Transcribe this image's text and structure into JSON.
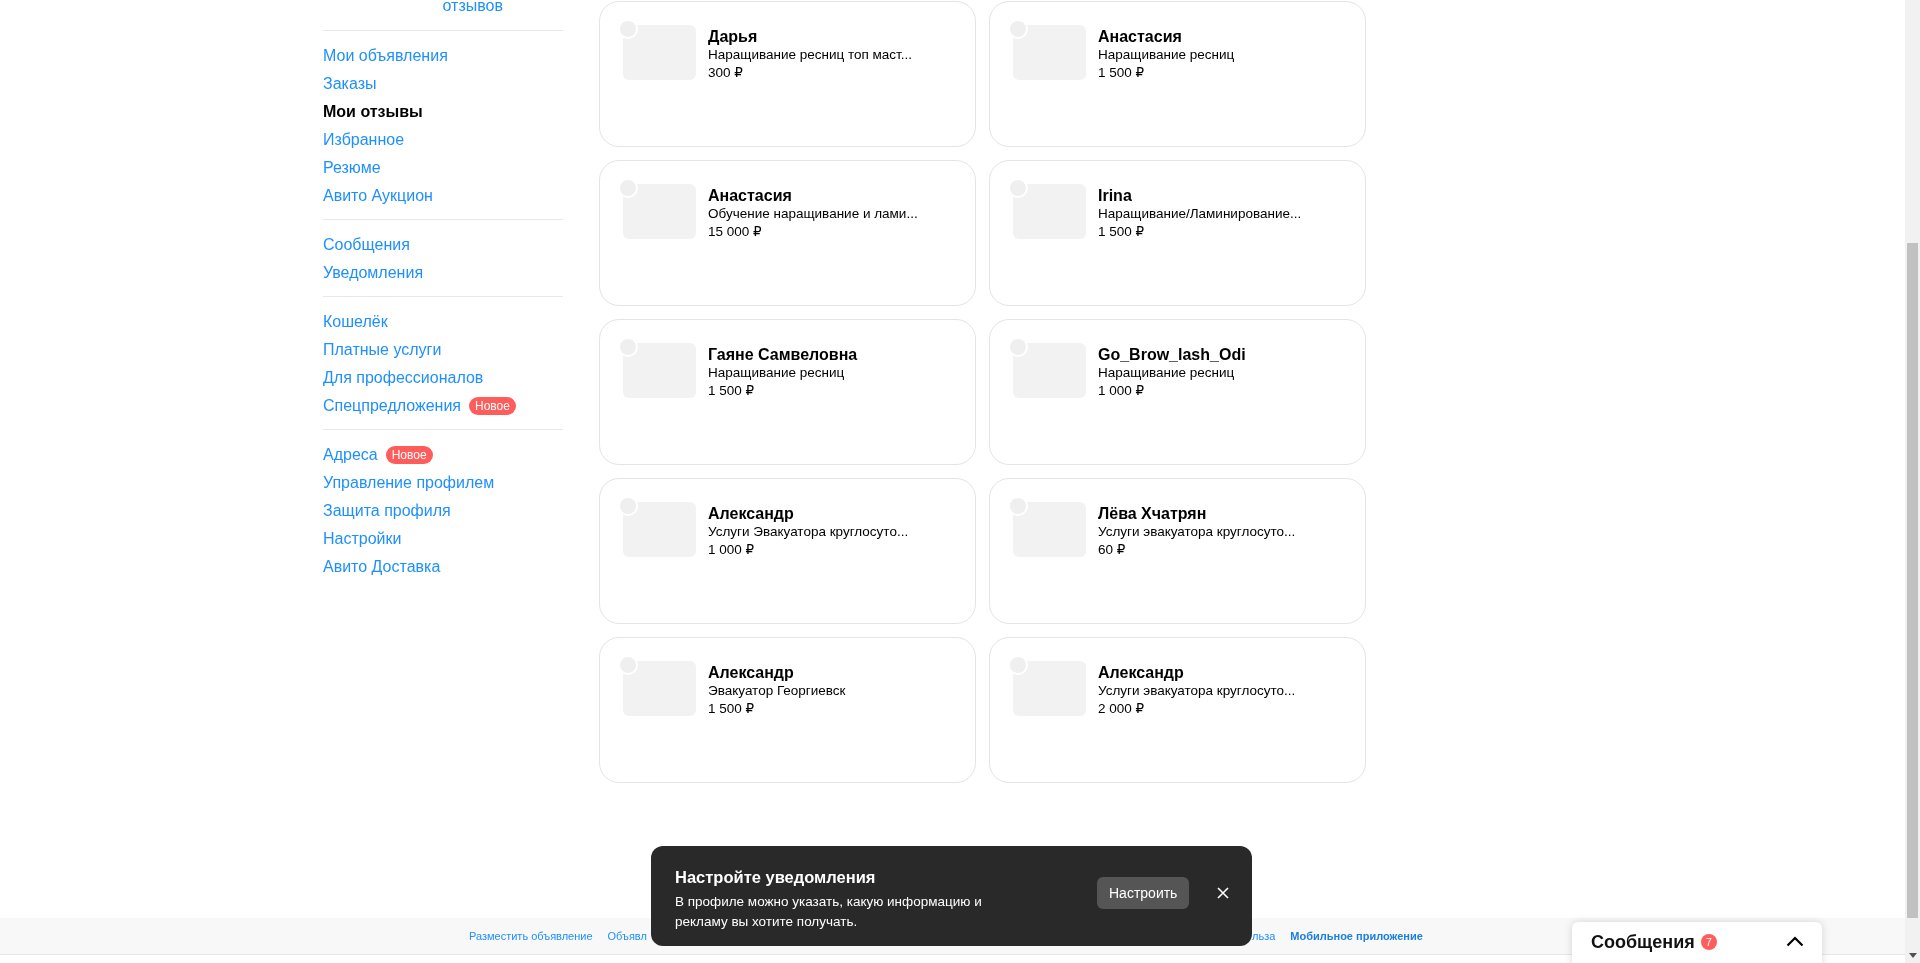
{
  "sidebar": {
    "top_link": "отзывов",
    "groups": [
      [
        {
          "label": "Мои объявления",
          "selected": false
        },
        {
          "label": "Заказы",
          "selected": false
        },
        {
          "label": "Мои отзывы",
          "selected": true
        },
        {
          "label": "Избранное",
          "selected": false
        },
        {
          "label": "Резюме",
          "selected": false
        },
        {
          "label": "Авито Аукцион",
          "selected": false
        }
      ],
      [
        {
          "label": "Сообщения",
          "selected": false
        },
        {
          "label": "Уведомления",
          "selected": false
        }
      ],
      [
        {
          "label": "Кошелёк",
          "selected": false
        },
        {
          "label": "Платные услуги",
          "selected": false
        },
        {
          "label": "Для профессионалов",
          "selected": false
        },
        {
          "label": "Спецпредложения",
          "selected": false,
          "badge": "Новое"
        }
      ],
      [
        {
          "label": "Адреса",
          "selected": false,
          "badge": "Новое"
        },
        {
          "label": "Управление профилем",
          "selected": false
        },
        {
          "label": "Защита профиля",
          "selected": false
        },
        {
          "label": "Настройки",
          "selected": false
        },
        {
          "label": "Авито Доставка",
          "selected": false
        }
      ]
    ]
  },
  "reviews": [
    {
      "name": "Дарья",
      "description": "Наращивание ресниц топ маст...",
      "price": "300 ₽"
    },
    {
      "name": "Анастасия",
      "description": "Наращивание ресниц",
      "price": "1 500 ₽"
    },
    {
      "name": "Анастасия",
      "description": "Обучение наращивание и лами...",
      "price": "15 000 ₽"
    },
    {
      "name": "Irina",
      "description": "Наращивание/Ламинирование...",
      "price": "1 500 ₽"
    },
    {
      "name": "Гаяне Самвеловна",
      "description": "Наращивание ресниц",
      "price": "1 500 ₽"
    },
    {
      "name": "Go_Brow_lash_Odi",
      "description": "Наращивание ресниц",
      "price": "1 000 ₽"
    },
    {
      "name": "Александр",
      "description": "Услуги Эвакуатора круглосуто...",
      "price": "1 000 ₽"
    },
    {
      "name": "Лёва Хчатрян",
      "description": "Услуги эвакуатора круглосуто...",
      "price": "60 ₽"
    },
    {
      "name": "Александр",
      "description": "Эвакуатор Георгиевск",
      "price": "1 500 ₽"
    },
    {
      "name": "Александр",
      "description": "Услуги эвакуатора круглосуто...",
      "price": "2 000 ₽"
    }
  ],
  "footer": {
    "links_left": [
      "Разместить объявление",
      "Объявл"
    ],
    "links_right": [
      {
        "label": "льза",
        "bold": false
      },
      {
        "label": "Мобильное приложение",
        "bold": true
      }
    ]
  },
  "toast": {
    "title": "Настройте уведомления",
    "text": "В профиле можно указать, какую информацию и рекламу вы хотите получать.",
    "button": "Настроить"
  },
  "messages_widget": {
    "label": "Сообщения",
    "count": "7"
  }
}
